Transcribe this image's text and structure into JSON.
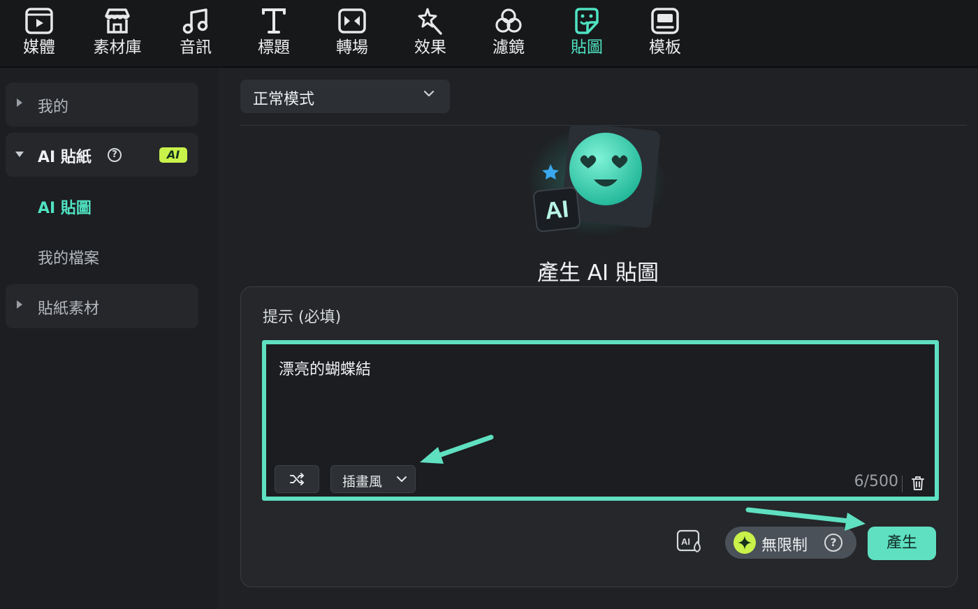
{
  "toolbar": {
    "items": [
      {
        "label": "媒體",
        "icon": "media-icon"
      },
      {
        "label": "素材庫",
        "icon": "store-icon"
      },
      {
        "label": "音訊",
        "icon": "music-note-icon"
      },
      {
        "label": "標題",
        "icon": "text-t-icon"
      },
      {
        "label": "轉場",
        "icon": "transition-icon"
      },
      {
        "label": "效果",
        "icon": "magic-star-icon"
      },
      {
        "label": "濾鏡",
        "icon": "filter-circles-icon"
      },
      {
        "label": "貼圖",
        "icon": "sticker-icon",
        "active": true
      },
      {
        "label": "模板",
        "icon": "template-icon"
      }
    ]
  },
  "sidebar": {
    "mine": "我的",
    "ai_sticker": "AI 貼紙",
    "ai_badge": "AI",
    "help_glyph": "?",
    "sub_ai_sticker": "AI 貼圖",
    "sub_my_files": "我的檔案",
    "sticker_assets": "貼紙素材"
  },
  "main": {
    "mode_value": "正常模式",
    "hero_badge": "AI",
    "title": "產生 AI 貼圖",
    "prompt_label": "提示 (必填)",
    "prompt_value": "漂亮的蝴蝶結",
    "style_value": "插畫風",
    "counter": "6/500",
    "unlimited_label": "無限制",
    "help_glyph": "?",
    "generate_label": "產生"
  },
  "colors": {
    "accent": "#5fe0c1",
    "accent_text": "#4fe3c2",
    "ai_badge": "#c9f24a",
    "background": "#1f2124"
  }
}
